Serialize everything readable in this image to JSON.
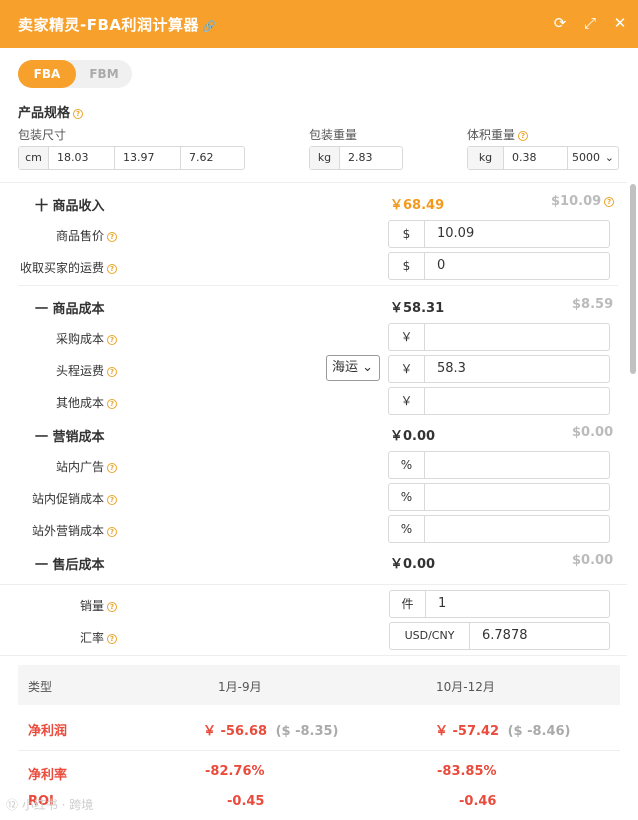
{
  "header": {
    "title": "卖家精灵-FBA利润计算器",
    "link_icon": "🔗",
    "refresh_icon": "⟳",
    "expand_icon": "⤢",
    "close_icon": "✕"
  },
  "tabs": [
    {
      "label": "FBA",
      "active": true
    },
    {
      "label": "FBM",
      "active": false
    }
  ],
  "spec": {
    "title": "产品规格",
    "dims_label": "包装尺寸",
    "dims_unit": "cm",
    "dims": [
      "18.03",
      "13.97",
      "7.62"
    ],
    "weight_label": "包装重量",
    "weight_unit": "kg",
    "weight": "2.83",
    "vol_label": "体积重量",
    "vol_unit": "kg",
    "vol": "0.38",
    "vol_divisor": "5000"
  },
  "income": {
    "title": "十 商品收入",
    "cny": "￥68.49",
    "usd": "$10.09",
    "price_label": "商品售价",
    "price_prefix": "$",
    "price": "10.09",
    "ship_label": "收取买家的运费",
    "ship_prefix": "$",
    "ship": "0"
  },
  "cost": {
    "title": "一 商品成本",
    "cny": "￥58.31",
    "usd": "$8.59",
    "purchase_label": "采购成本",
    "purchase_prefix": "￥",
    "purchase": "",
    "freight_label": "头程运费",
    "freight_mode": "海运",
    "freight_prefix": "￥",
    "freight": "58.3",
    "other_label": "其他成本",
    "other_prefix": "￥",
    "other": ""
  },
  "marketing": {
    "title": "一 营销成本",
    "cny": "￥0.00",
    "usd": "$0.00",
    "ads_label": "站内广告",
    "promo_label": "站内促销成本",
    "external_label": "站外营销成本",
    "prefix": "%"
  },
  "aftersale": {
    "title": "一 售后成本",
    "cny": "￥0.00",
    "usd": "$0.00"
  },
  "volume": {
    "label": "销量",
    "unit": "件",
    "value": "1",
    "rate_label": "汇率",
    "rate_unit": "USD/CNY",
    "rate": "6.7878"
  },
  "results": {
    "col_type": "类型",
    "col_a": "1月-9月",
    "col_b": "10月-12月",
    "rows": [
      {
        "label": "净利润",
        "a_cny": "￥ -56.68",
        "a_usd": "($ -8.35)",
        "b_cny": "￥ -57.42",
        "b_usd": "($ -8.46)"
      },
      {
        "label": "净利率",
        "a_cny": "-82.76%",
        "b_cny": "-83.85%"
      },
      {
        "label": "ROI",
        "a_cny": "-0.45",
        "b_cny": "-0.46"
      }
    ]
  },
  "watermark": "⑫ 小红书 · 跨境"
}
